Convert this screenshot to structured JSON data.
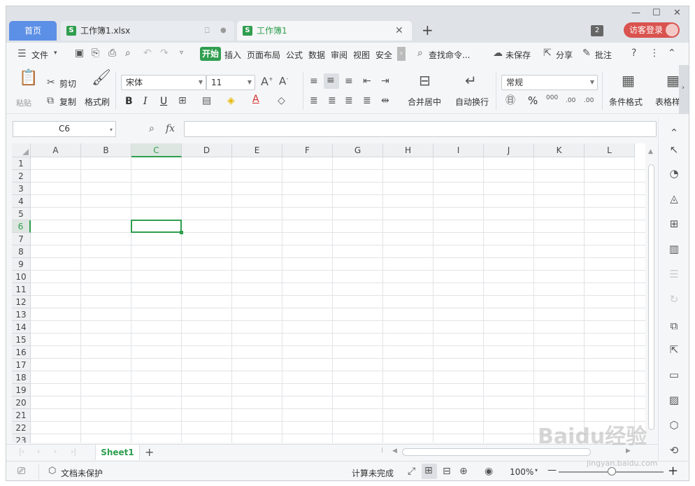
{
  "titlebar": {
    "home_tab": "首页",
    "tabs": [
      {
        "label": "工作簿1.xlsx",
        "icon": "spreadsheet-icon"
      },
      {
        "label": "工作簿1",
        "icon": "spreadsheet-icon"
      }
    ],
    "new_tab": "+",
    "window_count": "2",
    "login_label": "访客登录",
    "controls": {
      "minimize": "—",
      "maximize": "☐",
      "close": "✕"
    }
  },
  "menubar": {
    "file_label": "文件",
    "items": [
      "开始",
      "插入",
      "页面布局",
      "公式",
      "数据",
      "审阅",
      "视图",
      "安全"
    ],
    "search_placeholder": "查找命令...",
    "save_status": "未保存",
    "share": "分享",
    "comment": "批注"
  },
  "ribbon": {
    "paste": "粘贴",
    "cut": "剪切",
    "copy": "复制",
    "format_painter": "格式刷",
    "font_name": "宋体",
    "font_size": "11",
    "bold": "B",
    "italic": "I",
    "underline": "U",
    "merge_center": "合并居中",
    "wrap_text": "自动换行",
    "number_format": "常规",
    "percent": "%",
    "thousands": "000",
    "inc_decimal": ".00",
    "dec_decimal": ".00",
    "cond_format": "条件格式",
    "table_style": "表格样"
  },
  "formula": {
    "cell_ref": "C6",
    "fx_label": "fx",
    "value": ""
  },
  "grid": {
    "columns": [
      "A",
      "B",
      "C",
      "D",
      "E",
      "F",
      "G",
      "H",
      "I",
      "J",
      "K",
      "L"
    ],
    "rows": [
      "1",
      "2",
      "3",
      "4",
      "5",
      "6",
      "7",
      "8",
      "9",
      "10",
      "11",
      "12",
      "13",
      "14",
      "15",
      "16",
      "17",
      "18",
      "19",
      "20",
      "21",
      "22",
      "23"
    ],
    "selected_column": "C",
    "selected_row": "6"
  },
  "sheets": {
    "tabs": [
      "Sheet1"
    ],
    "add": "+"
  },
  "status": {
    "protection": "文档未保护",
    "calc_status": "计算未完成",
    "zoom": "100%",
    "zoom_out": "—",
    "zoom_in": "+"
  },
  "watermark": {
    "brand": "Baidu经验",
    "sub": "jingyan.baidu.com"
  },
  "colors": {
    "accent": "#2f9e4f",
    "home_tab": "#5c8fe6",
    "login": "#d9534f"
  }
}
